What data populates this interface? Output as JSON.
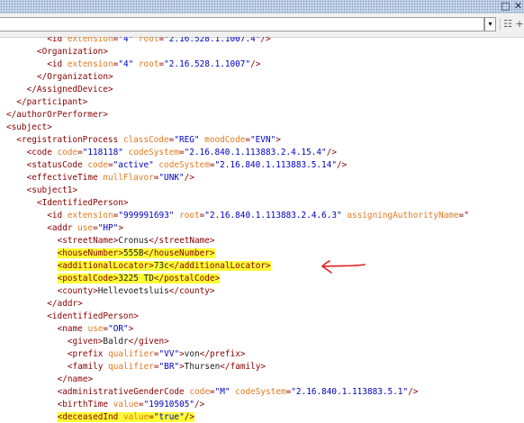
{
  "window": {
    "minimize_icon": "minimize-icon",
    "close_icon": "close-icon"
  },
  "toolbar": {
    "address_value": "",
    "dropdown_glyph": "▾",
    "icons": [
      "page-icon",
      "add-icon"
    ]
  },
  "colors": {
    "tag": "#880000",
    "attr_name": "#e37a1f",
    "attr_value": "#0000c0",
    "highlight": "#fdfd38",
    "annotation": "#e0201e"
  },
  "lines": [
    {
      "indent": 8,
      "parts": [
        [
          "t",
          "<id "
        ],
        [
          "a",
          "extension"
        ],
        [
          "t",
          "="
        ],
        [
          "v",
          "\"4\""
        ],
        [
          "x",
          " "
        ],
        [
          "a",
          "root"
        ],
        [
          "t",
          "="
        ],
        [
          "v",
          "\"2.16.528.1.1007.4\""
        ],
        [
          "t",
          "/>"
        ]
      ]
    },
    {
      "indent": 6,
      "parts": [
        [
          "t",
          "<Organization>"
        ]
      ]
    },
    {
      "indent": 8,
      "parts": [
        [
          "t",
          "<id "
        ],
        [
          "a",
          "extension"
        ],
        [
          "t",
          "="
        ],
        [
          "v",
          "\"4\""
        ],
        [
          "x",
          " "
        ],
        [
          "a",
          "root"
        ],
        [
          "t",
          "="
        ],
        [
          "v",
          "\"2.16.528.1.1007\""
        ],
        [
          "t",
          "/>"
        ]
      ]
    },
    {
      "indent": 6,
      "parts": [
        [
          "t",
          "</Organization>"
        ]
      ]
    },
    {
      "indent": 4,
      "parts": [
        [
          "t",
          "</AssignedDevice>"
        ]
      ]
    },
    {
      "indent": 2,
      "parts": [
        [
          "t",
          "</participant>"
        ]
      ]
    },
    {
      "indent": 0,
      "parts": [
        [
          "t",
          "</authorOrPerformer>"
        ]
      ]
    },
    {
      "indent": 0,
      "parts": [
        [
          "t",
          "<subject>"
        ]
      ]
    },
    {
      "indent": 2,
      "parts": [
        [
          "t",
          "<registrationProcess "
        ],
        [
          "a",
          "classCode"
        ],
        [
          "t",
          "="
        ],
        [
          "v",
          "\"REG\""
        ],
        [
          "x",
          " "
        ],
        [
          "a",
          "moodCode"
        ],
        [
          "t",
          "="
        ],
        [
          "v",
          "\"EVN\""
        ],
        [
          "t",
          ">"
        ]
      ]
    },
    {
      "indent": 4,
      "parts": [
        [
          "t",
          "<code "
        ],
        [
          "a",
          "code"
        ],
        [
          "t",
          "="
        ],
        [
          "v",
          "\"118118\""
        ],
        [
          "x",
          " "
        ],
        [
          "a",
          "codeSystem"
        ],
        [
          "t",
          "="
        ],
        [
          "v",
          "\"2.16.840.1.113883.2.4.15.4\""
        ],
        [
          "t",
          "/>"
        ]
      ]
    },
    {
      "indent": 4,
      "parts": [
        [
          "t",
          "<statusCode "
        ],
        [
          "a",
          "code"
        ],
        [
          "t",
          "="
        ],
        [
          "v",
          "\"active\""
        ],
        [
          "x",
          " "
        ],
        [
          "a",
          "codeSystem"
        ],
        [
          "t",
          "="
        ],
        [
          "v",
          "\"2.16.840.1.113883.5.14\""
        ],
        [
          "t",
          "/>"
        ]
      ]
    },
    {
      "indent": 4,
      "parts": [
        [
          "t",
          "<effectiveTime "
        ],
        [
          "a",
          "nullFlavor"
        ],
        [
          "t",
          "="
        ],
        [
          "v",
          "\"UNK\""
        ],
        [
          "t",
          "/>"
        ]
      ]
    },
    {
      "indent": 4,
      "parts": [
        [
          "t",
          "<subject1>"
        ]
      ]
    },
    {
      "indent": 6,
      "parts": [
        [
          "t",
          "<IdentifiedPerson>"
        ]
      ]
    },
    {
      "indent": 8,
      "parts": [
        [
          "t",
          "<id "
        ],
        [
          "a",
          "extension"
        ],
        [
          "t",
          "="
        ],
        [
          "v",
          "\"999991693\""
        ],
        [
          "x",
          " "
        ],
        [
          "a",
          "root"
        ],
        [
          "t",
          "="
        ],
        [
          "v",
          "\"2.16.840.1.113883.2.4.6.3\""
        ],
        [
          "x",
          " "
        ],
        [
          "a",
          "assigningAuthorityName"
        ],
        [
          "t",
          "=\""
        ]
      ]
    },
    {
      "indent": 8,
      "parts": [
        [
          "t",
          "<addr "
        ],
        [
          "a",
          "use"
        ],
        [
          "t",
          "="
        ],
        [
          "v",
          "\"HP\""
        ],
        [
          "t",
          ">"
        ]
      ]
    },
    {
      "indent": 10,
      "parts": [
        [
          "t",
          "<streetName>"
        ],
        [
          "x",
          "Cronus"
        ],
        [
          "t",
          "</streetName>"
        ]
      ]
    },
    {
      "indent": 10,
      "highlight": true,
      "parts": [
        [
          "t",
          "<houseNumber>"
        ],
        [
          "x",
          "555B"
        ],
        [
          "t",
          "</houseNumber>"
        ]
      ]
    },
    {
      "indent": 10,
      "highlight": true,
      "parts": [
        [
          "t",
          "<additionalLocator>"
        ],
        [
          "x",
          "73c"
        ],
        [
          "t",
          "</additionalLocator>"
        ]
      ]
    },
    {
      "indent": 10,
      "highlight": true,
      "parts": [
        [
          "t",
          "<postalCode>"
        ],
        [
          "x",
          "3225 TD"
        ],
        [
          "t",
          "</postalCode>"
        ]
      ]
    },
    {
      "indent": 10,
      "parts": [
        [
          "t",
          "<county>"
        ],
        [
          "x",
          "Hellevoetsluis"
        ],
        [
          "t",
          "</county>"
        ]
      ]
    },
    {
      "indent": 8,
      "parts": [
        [
          "t",
          "</addr>"
        ]
      ]
    },
    {
      "indent": 8,
      "parts": [
        [
          "t",
          "<identifiedPerson>"
        ]
      ]
    },
    {
      "indent": 10,
      "parts": [
        [
          "t",
          "<name "
        ],
        [
          "a",
          "use"
        ],
        [
          "t",
          "="
        ],
        [
          "v",
          "\"OR\""
        ],
        [
          "t",
          ">"
        ]
      ]
    },
    {
      "indent": 12,
      "parts": [
        [
          "t",
          "<given>"
        ],
        [
          "x",
          "Baldr"
        ],
        [
          "t",
          "</given>"
        ]
      ]
    },
    {
      "indent": 12,
      "parts": [
        [
          "t",
          "<prefix "
        ],
        [
          "a",
          "qualifier"
        ],
        [
          "t",
          "="
        ],
        [
          "v",
          "\"VV\""
        ],
        [
          "t",
          ">"
        ],
        [
          "x",
          "von"
        ],
        [
          "t",
          "</prefix>"
        ]
      ]
    },
    {
      "indent": 12,
      "parts": [
        [
          "t",
          "<family "
        ],
        [
          "a",
          "qualifier"
        ],
        [
          "t",
          "="
        ],
        [
          "v",
          "\"BR\""
        ],
        [
          "t",
          ">"
        ],
        [
          "x",
          "Thursen"
        ],
        [
          "t",
          "</family>"
        ]
      ]
    },
    {
      "indent": 10,
      "parts": [
        [
          "t",
          "</name>"
        ]
      ]
    },
    {
      "indent": 10,
      "parts": [
        [
          "t",
          "<administrativeGenderCode "
        ],
        [
          "a",
          "code"
        ],
        [
          "t",
          "="
        ],
        [
          "v",
          "\"M\""
        ],
        [
          "x",
          " "
        ],
        [
          "a",
          "codeSystem"
        ],
        [
          "t",
          "="
        ],
        [
          "v",
          "\"2.16.840.1.113883.5.1\""
        ],
        [
          "t",
          "/>"
        ]
      ]
    },
    {
      "indent": 10,
      "parts": [
        [
          "t",
          "<birthTime "
        ],
        [
          "a",
          "value"
        ],
        [
          "t",
          "="
        ],
        [
          "v",
          "\"19910505\""
        ],
        [
          "t",
          "/>"
        ]
      ]
    },
    {
      "indent": 10,
      "highlight": true,
      "parts": [
        [
          "t",
          "<deceasedInd "
        ],
        [
          "a",
          "value"
        ],
        [
          "t",
          "="
        ],
        [
          "v",
          "\"true\""
        ],
        [
          "t",
          "/>"
        ]
      ]
    }
  ]
}
